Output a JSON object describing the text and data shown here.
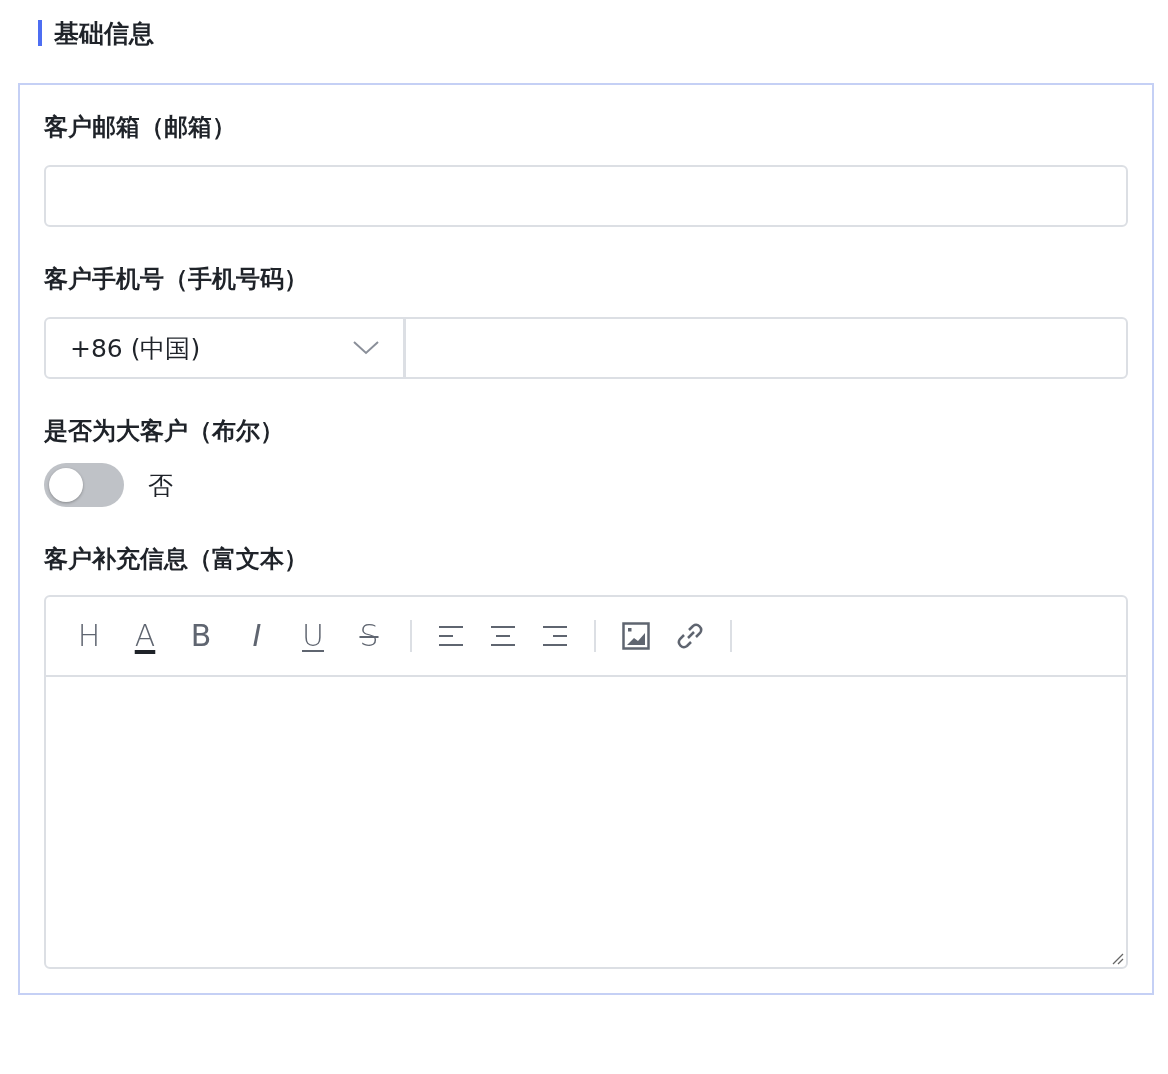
{
  "section": {
    "title": "基础信息"
  },
  "fields": [
    {
      "kind": "text",
      "label": "客户邮箱（邮箱）"
    },
    {
      "kind": "phone",
      "label": "客户手机号（手机号码）",
      "country_code": "+86 (中国)"
    },
    {
      "kind": "switch",
      "label": "是否为大客户（布尔）",
      "on": false,
      "state_text": "否"
    },
    {
      "kind": "richtext",
      "label": "客户补充信息（富文本）",
      "toolbar_groups": [
        [
          {
            "kind": "heading",
            "label": "H"
          },
          {
            "kind": "color",
            "label": "A"
          },
          {
            "kind": "bold",
            "label": "B"
          },
          {
            "kind": "italic",
            "label": "I"
          },
          {
            "kind": "underline",
            "label": "U"
          },
          {
            "kind": "strike",
            "label": "S"
          }
        ],
        [
          {
            "kind": "align-left"
          },
          {
            "kind": "align-center"
          },
          {
            "kind": "align-right"
          }
        ],
        [
          {
            "kind": "image"
          },
          {
            "kind": "link"
          }
        ]
      ]
    }
  ]
}
